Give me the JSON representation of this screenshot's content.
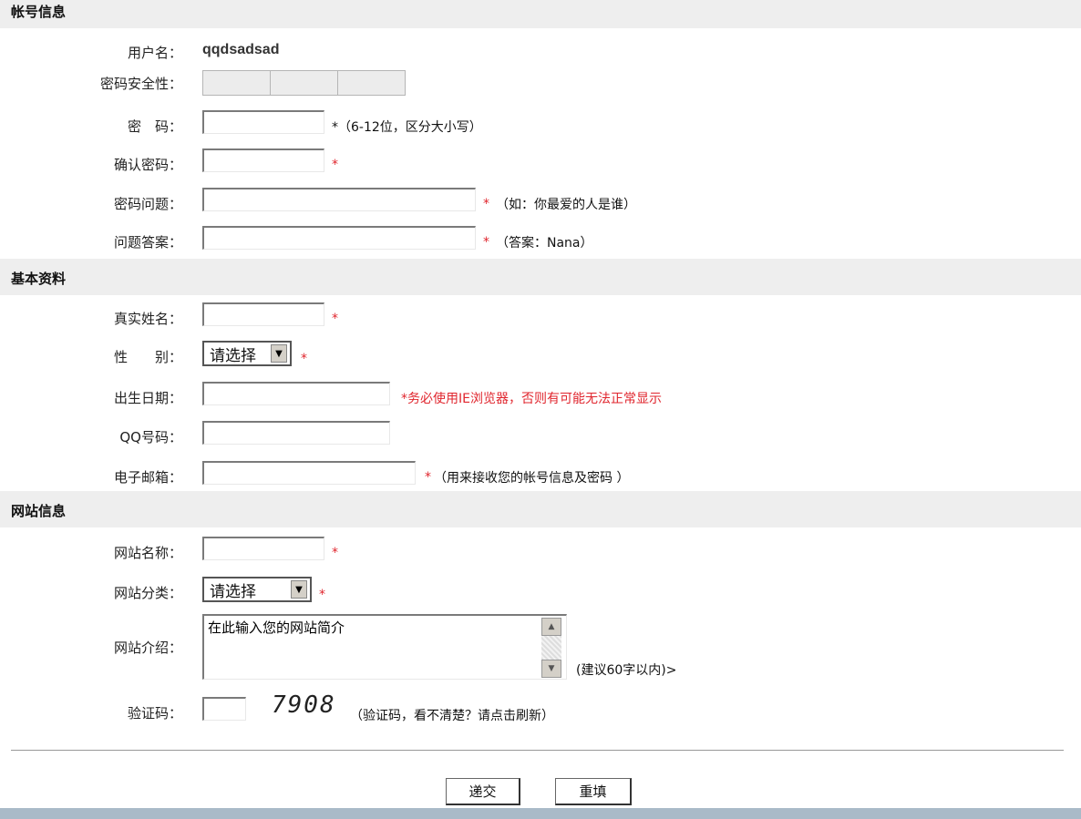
{
  "sections": {
    "account": "帐号信息",
    "basic": "基本资料",
    "website": "网站信息"
  },
  "account": {
    "username_label": "用户名：",
    "username_value": "qqdsadsad",
    "strength_label": "密码安全性：",
    "password_label": "密　码：",
    "password_hint": "*（6-12位，区分大小写）",
    "confirm_label": "确认密码：",
    "question_label": "密码问题：",
    "question_hint": "（如：你最爱的人是谁）",
    "answer_label": "问题答案：",
    "answer_hint": "（答案：Nana）"
  },
  "basic": {
    "realname_label": "真实姓名：",
    "gender_label": "性　　别：",
    "gender_value": "请选择",
    "birth_label": "出生日期：",
    "birth_hint": "*务必使用IE浏览器，否则有可能无法正常显示",
    "qq_label": "QQ号码：",
    "email_label": "电子邮箱：",
    "email_hint": "（用来接收您的帐号信息及密码 ）"
  },
  "website": {
    "name_label": "网站名称：",
    "category_label": "网站分类：",
    "category_value": "请选择",
    "intro_label": "网站介绍：",
    "intro_value": "在此输入您的网站简介",
    "intro_hint": "(建议60字以内)>",
    "captcha_label": "验证码：",
    "captcha_value": "7908",
    "captcha_hint": "（验证码，看不清楚？请点击刷新）"
  },
  "required_mark": "*",
  "buttons": {
    "submit": "递交",
    "reset": "重填"
  },
  "colors": {
    "required": "#e0252d",
    "section_bg": "#eeeeee",
    "footer_bar": "#a9bac8"
  }
}
